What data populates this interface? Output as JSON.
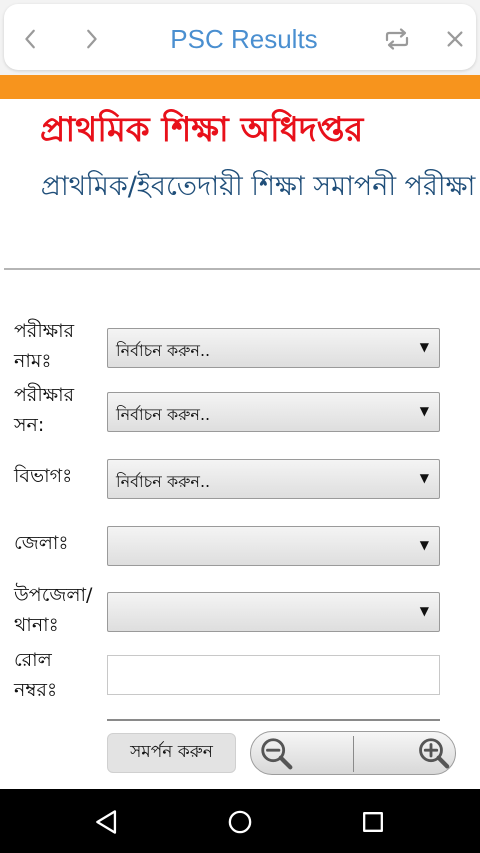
{
  "browser": {
    "title": "PSC Results"
  },
  "page": {
    "heading_main": "প্রাথমিক শিক্ষা অধিদপ্তর",
    "heading_sub": "প্রাথমিক/ইবতেদায়ী শিক্ষা সমাপনী পরীক্ষা"
  },
  "form": {
    "exam_name": {
      "label": "পরীক্ষার নামঃ",
      "value": "নির্বাচন করুন.."
    },
    "exam_year": {
      "label": "পরীক্ষার সন:",
      "value": "নির্বাচন করুন.."
    },
    "division": {
      "label": "বিভাগঃ",
      "value": "নির্বাচন করুন.."
    },
    "district": {
      "label": "জেলাঃ",
      "value": ""
    },
    "upazila": {
      "label": "উপজেলা/থানাঃ",
      "value": ""
    },
    "roll": {
      "label": "রোল নম্বরঃ",
      "value": ""
    },
    "submit_label": "সমর্পন করুন"
  },
  "colors": {
    "accent_band": "#f7941d",
    "heading_main": "#e8101a",
    "heading_sub": "#1f4e79",
    "browser_title": "#4a8fd0"
  },
  "icons": {
    "back": "chevron-left-icon",
    "forward": "chevron-right-icon",
    "refresh": "repeat-icon",
    "close": "close-icon",
    "zoom_out": "zoom-out-icon",
    "zoom_in": "zoom-in-icon",
    "nav_back": "triangle-back-icon",
    "nav_home": "circle-home-icon",
    "nav_recents": "square-recents-icon"
  }
}
